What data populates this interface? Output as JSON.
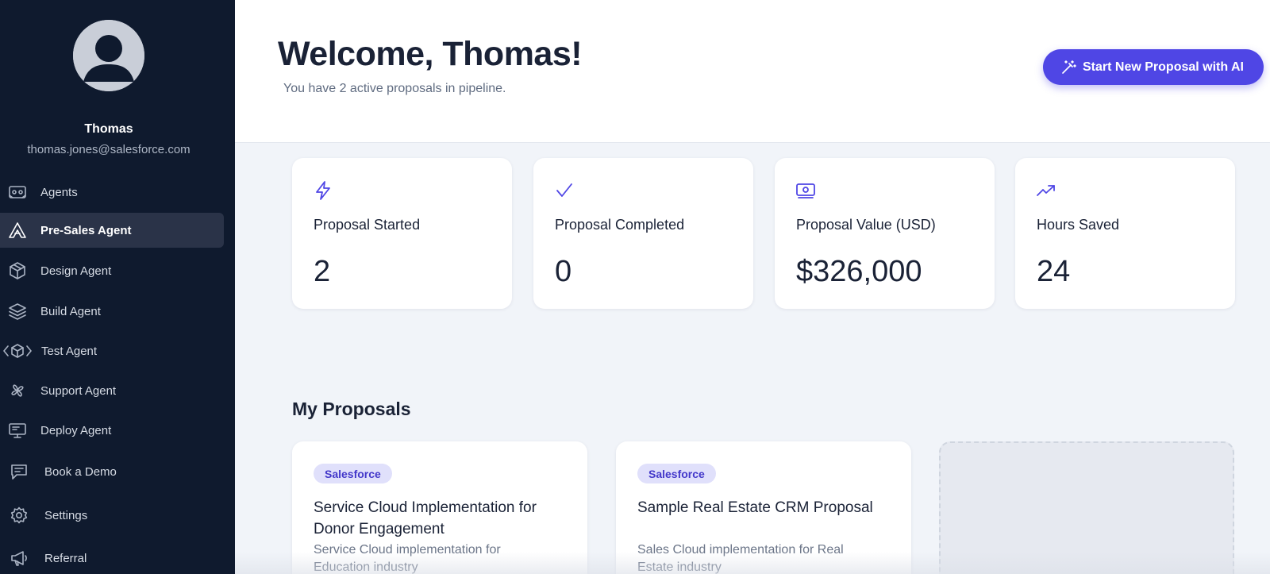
{
  "user": {
    "name": "Thomas",
    "email": "thomas.jones@salesforce.com"
  },
  "sidebar": {
    "items": [
      {
        "label": "Agents",
        "icon": "agents-icon",
        "active": false
      },
      {
        "label": "Pre-Sales Agent",
        "icon": "presales-icon",
        "active": true
      },
      {
        "label": "Design Agent",
        "icon": "cube-icon",
        "active": false
      },
      {
        "label": "Build Agent",
        "icon": "layers-icon",
        "active": false
      },
      {
        "label": "Test Agent",
        "icon": "code-box-icon",
        "active": false
      },
      {
        "label": "Support Agent",
        "icon": "support-icon",
        "active": false
      },
      {
        "label": "Deploy Agent",
        "icon": "monitor-icon",
        "active": false
      },
      {
        "label": "Book a Demo",
        "icon": "chat-icon",
        "active": false
      },
      {
        "label": "Settings",
        "icon": "gear-icon",
        "active": false
      },
      {
        "label": "Referral",
        "icon": "megaphone-icon",
        "active": false
      }
    ]
  },
  "header": {
    "title": "Welcome, Thomas!",
    "subtitle": "You have 2 active proposals in pipeline.",
    "cta_label": "Start New Proposal with AI"
  },
  "stats": [
    {
      "label": "Proposal Started",
      "value": "2",
      "icon": "lightning-icon"
    },
    {
      "label": "Proposal Completed",
      "value": "0",
      "icon": "check-icon"
    },
    {
      "label": "Proposal Value (USD)",
      "value": "$326,000",
      "icon": "money-icon"
    },
    {
      "label": "Hours Saved",
      "value": "24",
      "icon": "trending-up-icon"
    }
  ],
  "proposals": {
    "title": "My Proposals",
    "items": [
      {
        "tag": "Salesforce",
        "title": "Service Cloud Implementation for Donor Engagement",
        "description": "Service Cloud implementation for Education industry"
      },
      {
        "tag": "Salesforce",
        "title": "Sample Real Estate CRM Proposal",
        "description": "Sales Cloud implementation for Real Estate industry"
      }
    ]
  },
  "colors": {
    "sidebar_bg": "#0f1a2e",
    "accent": "#4f46e5",
    "page_bg": "#f1f4f9",
    "tag_bg": "#e0e0fb"
  }
}
